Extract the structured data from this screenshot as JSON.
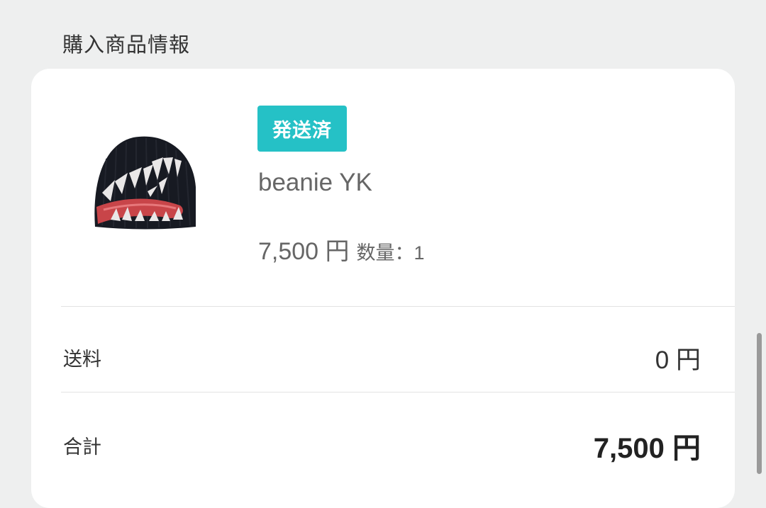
{
  "section": {
    "title": "購入商品情報"
  },
  "order_item": {
    "status_badge": "発送済",
    "name": "beanie YK",
    "price": "7,500 円",
    "quantity": "数量：1",
    "image_icon": "beanie-product-image"
  },
  "summary": {
    "shipping_label": "送料",
    "shipping_value": "0 円",
    "total_label": "合計",
    "total_value": "7,500 円"
  },
  "colors": {
    "background": "#eeefef",
    "card": "#ffffff",
    "status_badge": "#25c1c6",
    "muted_text": "#666666",
    "text": "#333333"
  }
}
